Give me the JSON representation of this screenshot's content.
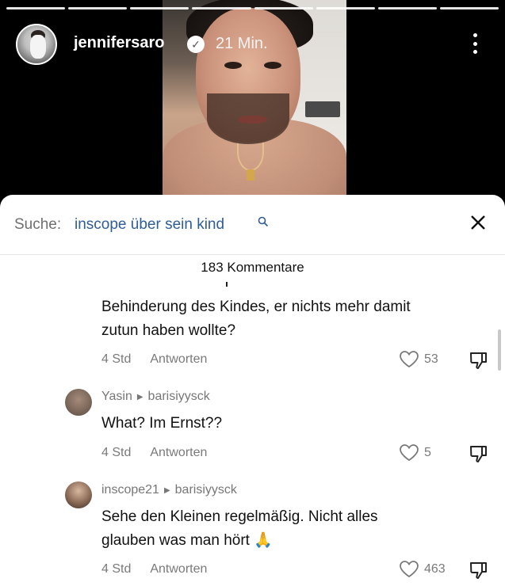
{
  "story": {
    "username": "jennifersaro",
    "verified_icon": "verified-badge-icon",
    "time": "21 Min.",
    "progress_segments": 8
  },
  "search": {
    "prefix": "Suche:",
    "query": "inscope über sein kind",
    "icon": "search-icon"
  },
  "comments_count": "183 Kommentare",
  "comments": [
    {
      "author": "",
      "reply_to": "",
      "text_lines": [
        "Behinderung des Kindes, er nichts mehr damit",
        "zutun haben wollte?"
      ],
      "age": "4 Std",
      "reply_label": "Antworten",
      "likes": "53"
    },
    {
      "author": "Yasin",
      "reply_to": "barisiyysck",
      "text_lines": [
        "What? Im Ernst??"
      ],
      "age": "4 Std",
      "reply_label": "Antworten",
      "likes": "5"
    },
    {
      "author": "inscope21",
      "reply_to": "barisiyysck",
      "text_lines": [
        "Sehe den Kleinen regelmäßig. Nicht alles",
        "glauben was man hört 🙏"
      ],
      "age": "4 Std",
      "reply_label": "Antworten",
      "likes": "463"
    }
  ],
  "colors": {
    "link_blue": "#2f5d95",
    "meta_gray": "#777777"
  }
}
